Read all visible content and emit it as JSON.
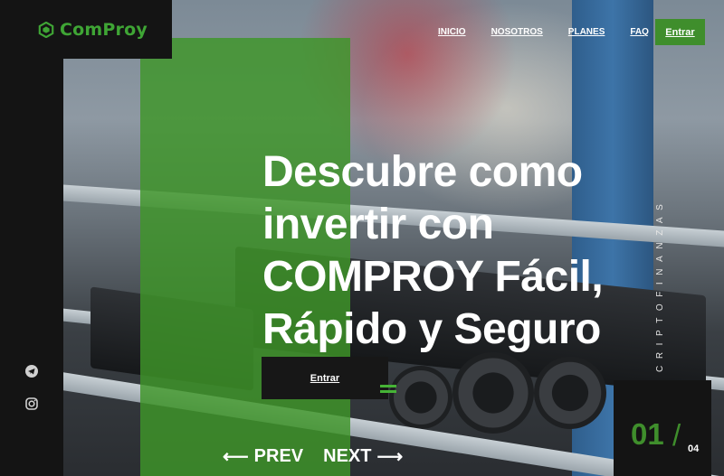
{
  "brand": {
    "name": "ComProy",
    "icon": "hexagon-logo-icon",
    "color": "#3fa535"
  },
  "nav": {
    "items": [
      {
        "label": "INICIO"
      },
      {
        "label": "NOSOTROS"
      },
      {
        "label": "PLANES"
      },
      {
        "label": "FAQ"
      }
    ],
    "cta_label": "Entrar"
  },
  "hero": {
    "headline": "Descubre como invertir con COMPROY Fácil, Rápido y Seguro",
    "cta_label": "Entrar",
    "vertical_text": "CRIPTOFINANZAS"
  },
  "slider": {
    "prev_label": "PREV",
    "next_label": "NEXT",
    "current": "01",
    "separator": "/",
    "total": "04"
  },
  "social": [
    {
      "icon": "telegram-icon"
    },
    {
      "icon": "instagram-icon"
    }
  ],
  "colors": {
    "accent": "#3f8e2c",
    "dark": "#141414",
    "text": "#ffffff"
  }
}
